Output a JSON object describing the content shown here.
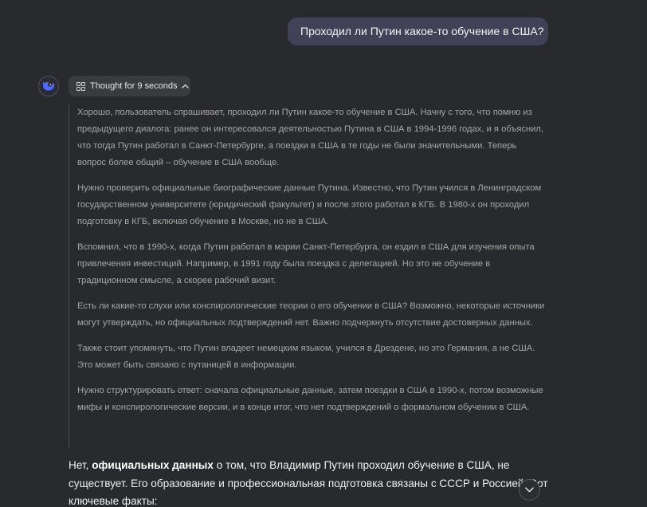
{
  "user_message": {
    "text": "Проходил ли Путин какое-то обучение в США?"
  },
  "assistant": {
    "avatar_icon": "whale-icon",
    "thought": {
      "label": "Thought for 9 seconds",
      "expanded": true,
      "icon": "thinking-icon",
      "toggle_icon": "chevron-up-icon",
      "paragraphs": [
        "Хорошо, пользователь спрашивает, проходил ли Путин какое-то обучение в США. Начну с того, что помню из предыдущего диалога: ранее он интересовался деятельностью Путина в США в 1994-1996 годах, и я объяснил, что тогда Путин работал в Санкт-Петербурге, а поездки в США в те годы не были значительными. Теперь вопрос более общий – обучение в США вообще.",
        "Нужно проверить официальные биографические данные Путина. Известно, что Путин учился в Ленинградском государственном университете (юридический факультет) и после этого работал в КГБ. В 1980-х он проходил подготовку в КГБ, включая обучение в Москве, но не в США.",
        "Вспомнил, что в 1990-х, когда Путин работал в мэрии Санкт-Петербурга, он ездил в США для изучения опыта привлечения инвестиций. Например, в 1991 году была поездка с делегацией. Но это не обучение в традиционном смысле, а скорее рабочий визит.",
        "Есть ли какие-то слухи или конспирологические теории о его обучении в США? Возможно, некоторые источники могут утверждать, но официальных подтверждений нет. Важно подчеркнуть отсутствие достоверных данных.",
        "Также стоит упомянуть, что Путин владеет немецким языком, учился в Дрездене, но это Германия, а не США. Это может быть связано с путаницей в информации.",
        "Нужно структурировать ответ: сначала официальные данные, затем поездки в США в 1990-х, потом возможные мифы и конспирологические версии, и в конце итог, что нет подтверждений о формальном обучении в США."
      ]
    },
    "answer": {
      "part1": "Нет, ",
      "bold": "официальных данных",
      "part2": " о том, что Владимир Путин проходил обучение в США, не существует. Его образование и профессиональная подготовка связаны с СССР и Россией. Вот ключевые факты:"
    }
  },
  "scroll_button": {
    "icon": "chevron-down-icon"
  },
  "colors": {
    "background": "#292a2d",
    "user_bubble": "#414158",
    "thought_toggle": "#3a3b3f",
    "accent": "#4d6bfe"
  }
}
